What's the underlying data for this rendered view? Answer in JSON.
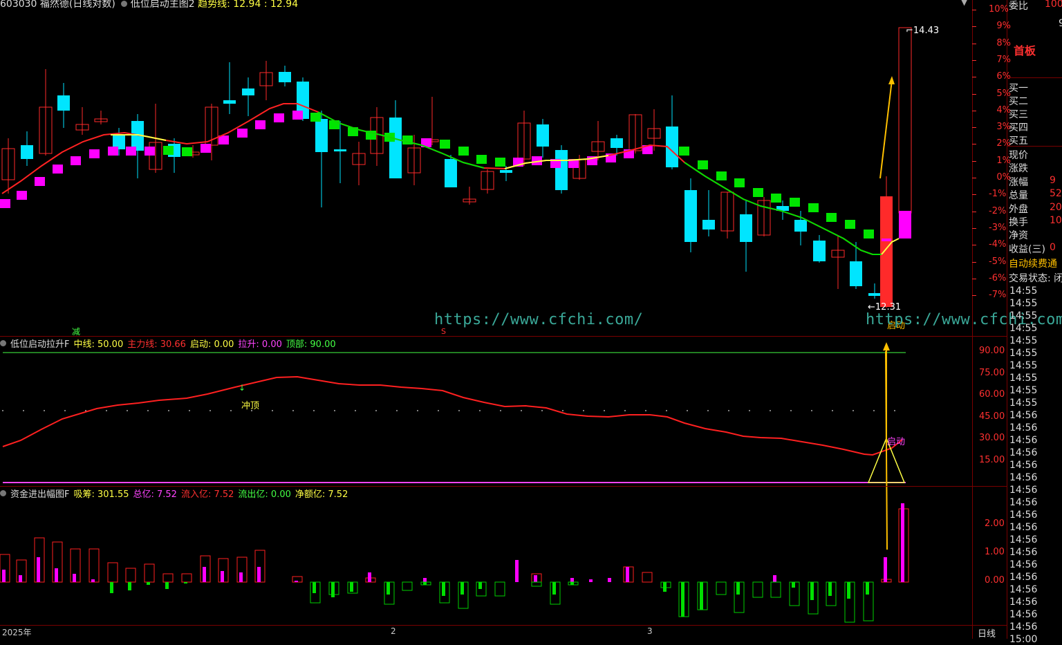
{
  "header": {
    "stock_code": "603030",
    "stock_name": "福然德(日线对数)",
    "indicator": "低位启动主图2",
    "trend_label": "趋势线:",
    "trend_value": "12.94",
    "trend_value2": "12.94"
  },
  "main_chart": {
    "pct_axis": [
      "10%",
      "9%",
      "8%",
      "7%",
      "6%",
      "5%",
      "4%",
      "3%",
      "2%",
      "1%",
      "0%",
      "-1%",
      "-2%",
      "-3%",
      "-4%",
      "-5%",
      "-6%",
      "-7%"
    ],
    "high_label": "14.43",
    "low_label": "12.31",
    "start_label": "启动",
    "reduce_label": "减",
    "s_label": "S",
    "colors": {
      "up": "#ff2a2a",
      "down": "#00e5ff",
      "ma": "#ff2222",
      "ma_green": "#00e000",
      "ma_yellow": "#ffff44",
      "magenta": "#ff00ff",
      "green_box": "#00e600",
      "arrow": "#ffc000"
    }
  },
  "indicator1": {
    "name": "低位启动拉升F",
    "fields": [
      {
        "label": "中线:",
        "value": "50.00",
        "color": "#ffff44"
      },
      {
        "label": "主力线:",
        "value": "30.66",
        "color": "#ff3030"
      },
      {
        "label": "启动:",
        "value": "0.00",
        "color": "#ffff44"
      },
      {
        "label": "拉升:",
        "value": "0.00",
        "color": "#ff44ff"
      },
      {
        "label": "顶部:",
        "value": "90.00",
        "color": "#44ff44"
      }
    ],
    "axis": [
      "90.00",
      "75.00",
      "60.00",
      "45.00",
      "30.00",
      "15.00"
    ],
    "top_label": "冲顶",
    "start_label": "启动"
  },
  "indicator2": {
    "name": "资金进出幅图F",
    "fields": [
      {
        "label": "吸筹:",
        "value": "301.55",
        "color": "#ffff44"
      },
      {
        "label": "总亿:",
        "value": "7.52",
        "color": "#ff44ff"
      },
      {
        "label": "流入亿:",
        "value": "7.52",
        "color": "#ff3030"
      },
      {
        "label": "流出亿:",
        "value": "0.00",
        "color": "#44ff44"
      },
      {
        "label": "净额亿:",
        "value": "7.52",
        "color": "#ffff44"
      }
    ],
    "axis": [
      "2.00",
      "1.00",
      "0.00"
    ]
  },
  "x_axis": {
    "labels": [
      "2025年",
      "2",
      "3"
    ],
    "period_button": "日线"
  },
  "side_panel": {
    "wei_bi": {
      "label": "委比",
      "value": "100"
    },
    "extra_value": "9",
    "first_board": "首板",
    "bid_labels": [
      "买一",
      "买二",
      "买三",
      "买四",
      "买五"
    ],
    "stats": [
      {
        "label": "现价",
        "value": ""
      },
      {
        "label": "涨跌",
        "value": ""
      },
      {
        "label": "涨幅",
        "value": "9"
      },
      {
        "label": "总量",
        "value": "52"
      },
      {
        "label": "外盘",
        "value": "20"
      },
      {
        "label": "换手",
        "value": "10"
      },
      {
        "label": "净资",
        "value": ""
      },
      {
        "label": "收益(三)",
        "value": "0"
      }
    ],
    "auto_renew": "自动续费通",
    "trade_status": "交易状态: 闭",
    "times": [
      "14:55",
      "14:55",
      "14:55",
      "14:55",
      "14:55",
      "14:55",
      "14:55",
      "14:55",
      "14:55",
      "14:55",
      "14:56",
      "14:56",
      "14:56",
      "14:56",
      "14:56",
      "14:56",
      "14:56",
      "14:56",
      "14:56",
      "14:56",
      "14:56",
      "14:56",
      "14:56",
      "14:56",
      "14:56",
      "14:56",
      "14:56",
      "14:56",
      "15:00"
    ]
  },
  "watermarks": [
    "https://www.cfchi.com/",
    "https://www.cfchi.com/"
  ]
}
